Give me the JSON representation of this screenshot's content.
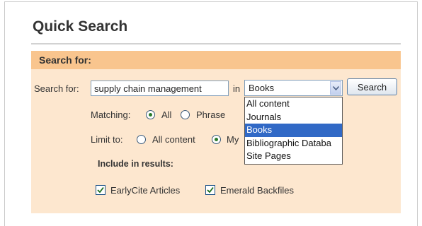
{
  "page": {
    "title": "Quick Search"
  },
  "panel": {
    "header": "Search for:",
    "search_label": "Search for:",
    "query_value": "supply chain management",
    "in_label": "in",
    "select_value": "Books",
    "search_button": "Search",
    "dropdown_options": [
      "All content",
      "Journals",
      "Books",
      "Bibliographic Databa",
      "Site Pages"
    ],
    "dropdown_selected": "Books",
    "matching": {
      "label": "Matching:",
      "options": [
        "All",
        "Phrase"
      ],
      "selected": "All"
    },
    "limit": {
      "label": "Limit to:",
      "options": [
        "All content",
        "My"
      ],
      "selected": "My"
    },
    "include_label": "Include in results:",
    "checkboxes": [
      {
        "label": "EarlyCite Articles",
        "checked": true
      },
      {
        "label": "Emerald Backfiles",
        "checked": true
      }
    ]
  },
  "colors": {
    "panel_background": "#fde7cf",
    "panel_header": "#f9c58e",
    "dropdown_highlight": "#3169c6",
    "radio_dot": "#2a7a2a"
  }
}
